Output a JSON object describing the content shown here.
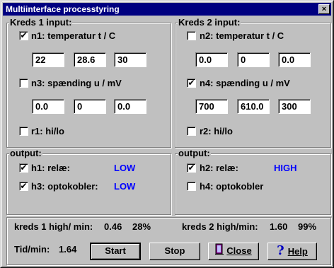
{
  "window": {
    "title": "Multiinterface processtyring",
    "close_glyph": "×"
  },
  "kreds1": {
    "title": "Kreds 1 input:",
    "n1": {
      "label": "n1: temperatur t / C",
      "checked": true,
      "values": [
        "22",
        "28.6",
        "30"
      ]
    },
    "n3": {
      "label": "n3: spænding u / mV",
      "checked": false,
      "values": [
        "0.0",
        "0",
        "0.0"
      ]
    },
    "r1": {
      "label": "r1: hi/lo",
      "checked": false
    }
  },
  "kreds2": {
    "title": "Kreds 2 input:",
    "n2": {
      "label": "n2: temperatur t / C",
      "checked": false,
      "values": [
        "0.0",
        "0",
        "0.0"
      ]
    },
    "n4": {
      "label": "n4: spænding u / mV",
      "checked": true,
      "values": [
        "700",
        "610.0",
        "300"
      ]
    },
    "r2": {
      "label": "r2: hi/lo",
      "checked": false
    }
  },
  "output1": {
    "title": "output:",
    "h1": {
      "label": "h1: relæ:",
      "checked": true,
      "status": "LOW"
    },
    "h3": {
      "label": "h3: optokobler:",
      "checked": true,
      "status": "LOW"
    }
  },
  "output2": {
    "title": "output:",
    "h2": {
      "label": "h2: relæ:",
      "checked": true,
      "status": "HIGH"
    },
    "h4": {
      "label": "h4: optokobler",
      "checked": false
    }
  },
  "stats": {
    "k1_label": "kreds 1 high/ min:",
    "k1_value": "0.46",
    "k1_pct": "28%",
    "k2_label": "kreds 2 high/min:",
    "k2_value": "1.60",
    "k2_pct": "99%",
    "tid_label": "Tid/min:",
    "tid_value": "1.64"
  },
  "buttons": {
    "start": "Start",
    "stop": "Stop",
    "close": "Close",
    "help": "Help",
    "help_icon_glyph": "?"
  },
  "colors": {
    "title_bar": "#000080",
    "status_text": "#0000ff",
    "face": "#c0c0c0"
  }
}
